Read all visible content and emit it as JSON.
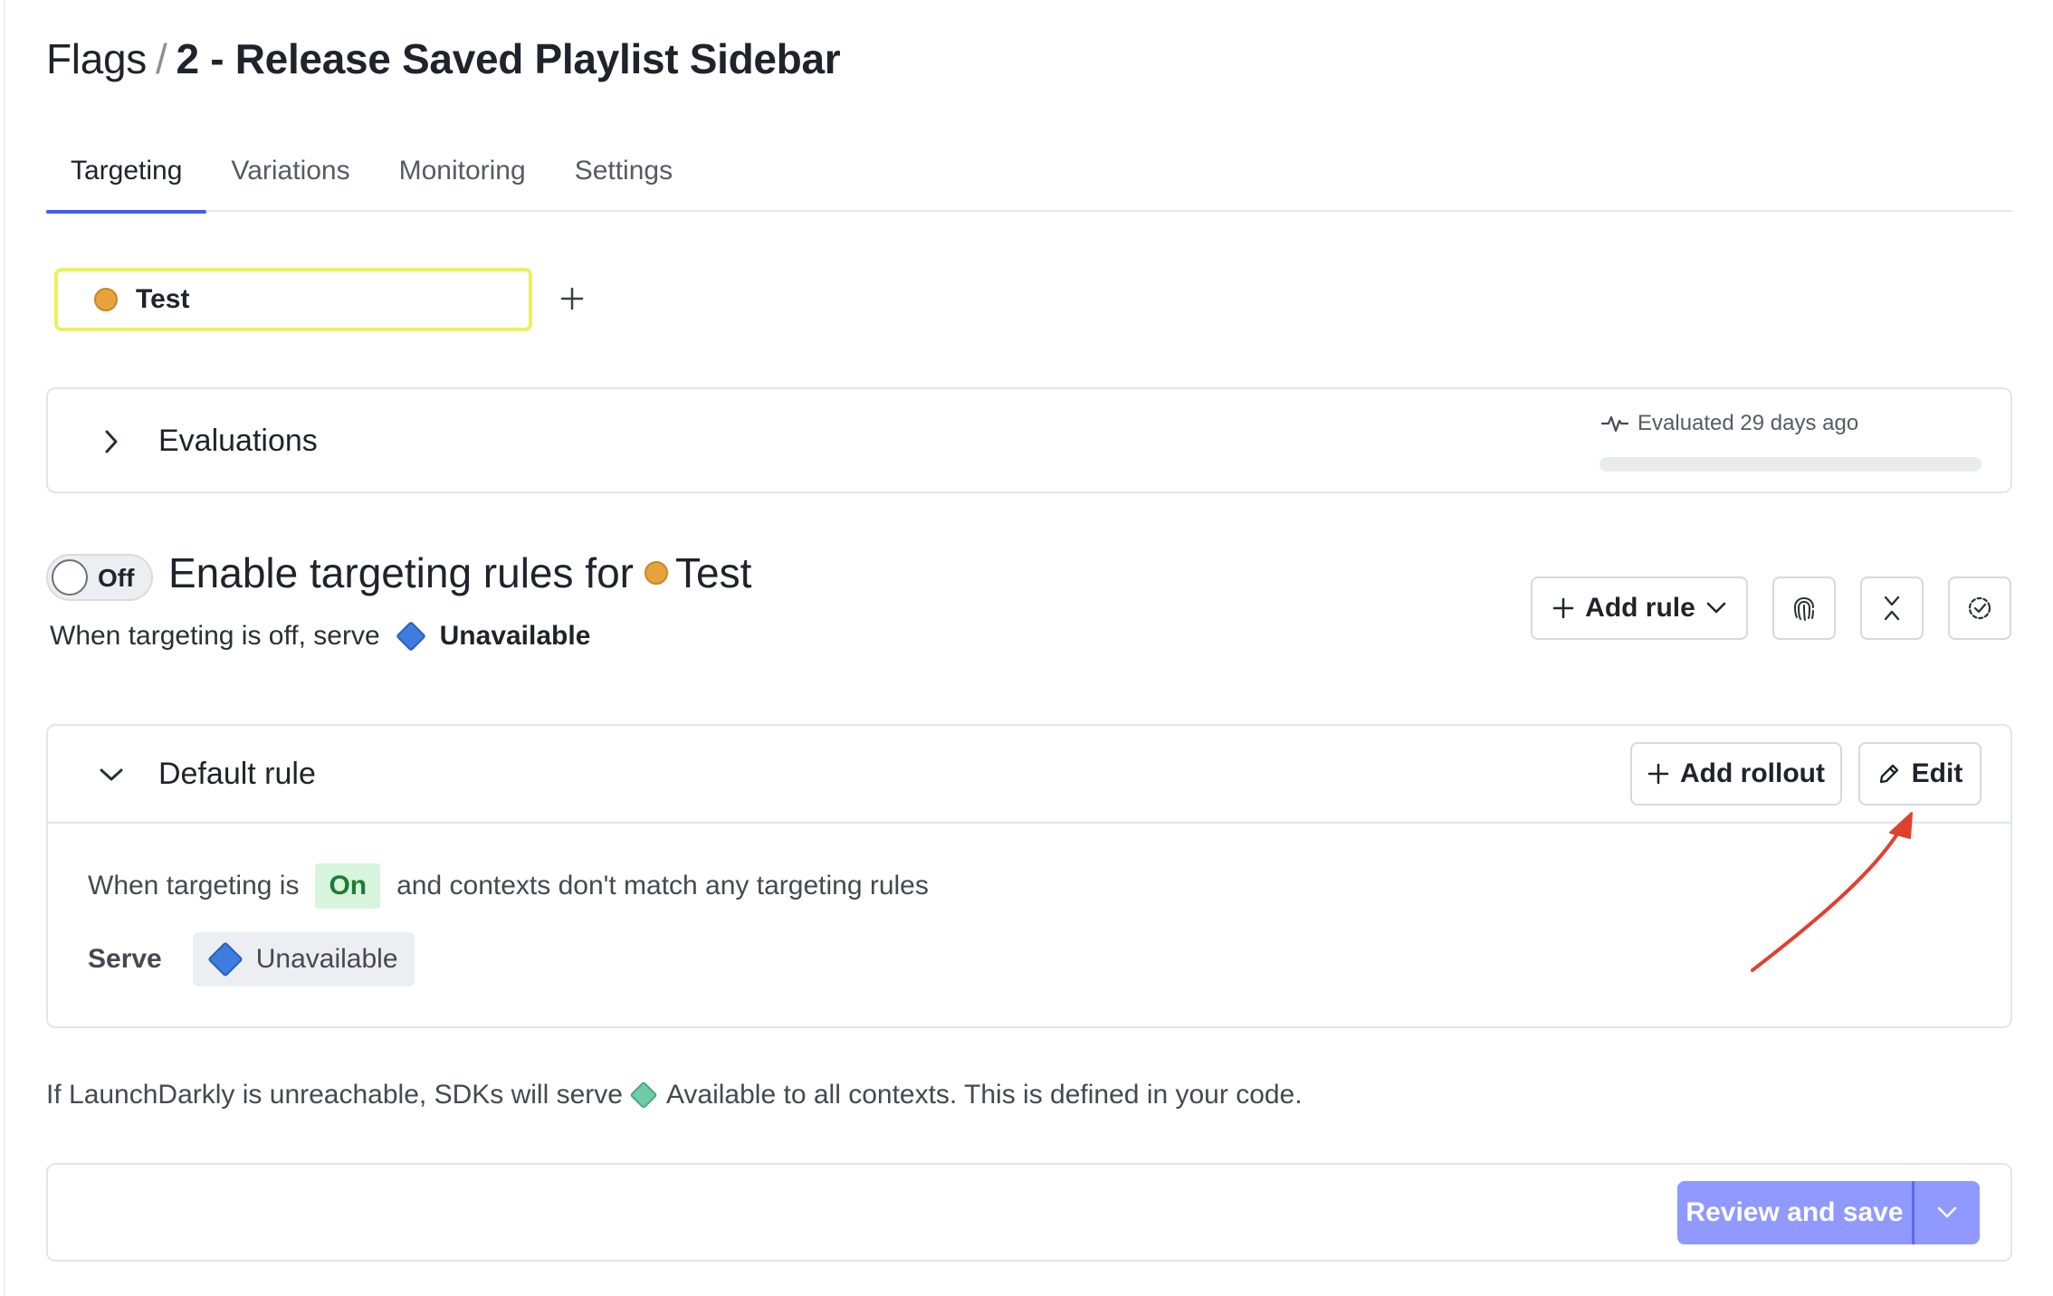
{
  "header": {
    "breadcrumb_root": "Flags",
    "separator": "/",
    "flag_name": "2 - Release Saved Playlist Sidebar"
  },
  "tabs": [
    {
      "label": "Targeting",
      "active": true
    },
    {
      "label": "Variations",
      "active": false
    },
    {
      "label": "Monitoring",
      "active": false
    },
    {
      "label": "Settings",
      "active": false
    }
  ],
  "environment": {
    "name": "Test",
    "color": "#e8a33d",
    "add_icon": "plus-icon"
  },
  "evaluations": {
    "title": "Evaluations",
    "meta": "Evaluated 29 days ago",
    "icon": "activity-icon"
  },
  "targeting": {
    "toggle_label": "Off",
    "toggle_on": false,
    "title_prefix": "Enable targeting rules for",
    "env_name": "Test",
    "off_serve_text": "When targeting is off, serve",
    "off_variation": "Unavailable"
  },
  "toolbar": {
    "add_rule_label": "Add rule",
    "fingerprint_icon": "fingerprint-icon",
    "collapse_icon": "collapse-all-icon",
    "check_icon": "check-circle-icon"
  },
  "default_rule": {
    "title": "Default rule",
    "add_rollout_label": "Add rollout",
    "edit_label": "Edit",
    "when_prefix": "When targeting is",
    "state_badge": "On",
    "when_suffix": "and contexts don't match any targeting rules",
    "serve_label": "Serve",
    "serve_variation": "Unavailable"
  },
  "fallback": {
    "prefix": "If LaunchDarkly is unreachable, SDKs will serve",
    "suffix": "Available to all contexts. This is defined in your code."
  },
  "footer": {
    "save_label": "Review and save"
  },
  "colors": {
    "accent": "#405bff",
    "save_button": "#8f99ff",
    "env_highlight": "#e9f25a",
    "variation_unavailable": "#3d7de0",
    "variation_available": "#6fcca7",
    "on_badge_bg": "#d6f5dc",
    "annotation_arrow": "#e2402f"
  }
}
